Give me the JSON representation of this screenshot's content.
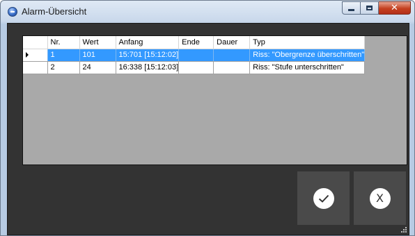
{
  "window": {
    "title": "Alarm-Übersicht",
    "app_icon": "app-logo-icon"
  },
  "titlebar_buttons": {
    "minimize": "minimize-icon",
    "maximize": "maximize-icon",
    "close": "close-icon"
  },
  "table": {
    "columns": [
      "Nr.",
      "Wert",
      "Anfang",
      "Ende",
      "Dauer",
      "Typ"
    ],
    "rows": [
      {
        "selected": true,
        "nr": "1",
        "wert": "101",
        "anfang": "15:701 [15:12:02]",
        "ende": "",
        "dauer": "",
        "typ": "Riss: \"Obergrenze überschritten\""
      },
      {
        "selected": false,
        "nr": "2",
        "wert": "24",
        "anfang": "16:338 [15:12:03]",
        "ende": "",
        "dauer": "",
        "typ": "Riss: \"Stufe unterschritten\""
      }
    ]
  },
  "buttons": {
    "confirm_icon": "checkmark-icon",
    "cancel_label": "X"
  },
  "colors": {
    "selection": "#3399ff",
    "client_bg": "#333333",
    "grid_bg": "#a9a9a9",
    "button_bg": "#4a4a4a"
  }
}
